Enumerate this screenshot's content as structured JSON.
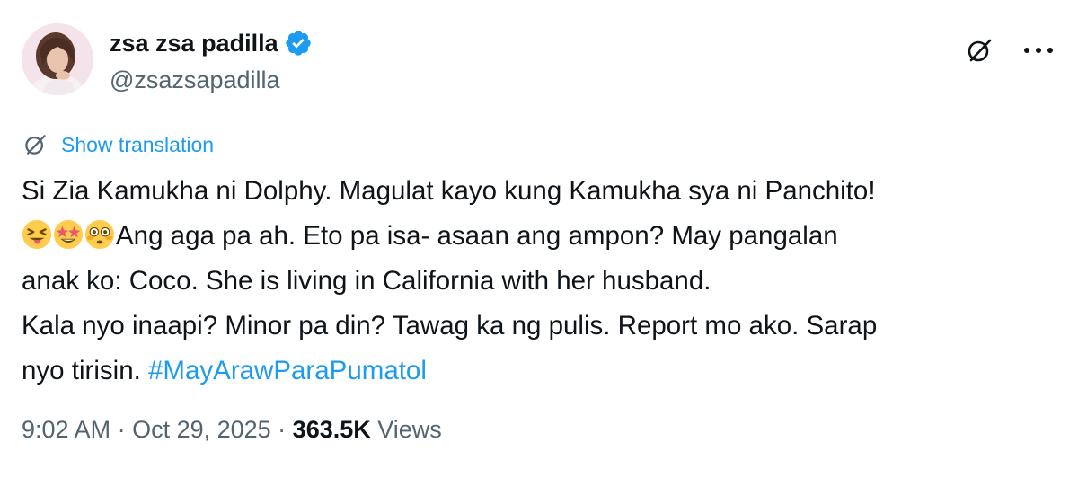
{
  "author": {
    "display_name": "zsa zsa padilla",
    "handle": "@zsazsapadilla",
    "verified": true,
    "avatar": "profile-photo"
  },
  "actions": {
    "grok_icon": "grok-icon",
    "more_icon": "more-icon"
  },
  "translation": {
    "icon": "translate-icon",
    "label": "Show translation"
  },
  "tweet": {
    "line1": "Si Zia Kamukha ni Dolphy. Magulat kayo kung Kamukha sya ni Panchito!",
    "emojis": [
      "squinting-face-with-tongue",
      "star-struck",
      "flushed-face"
    ],
    "line2_rest": "Ang aga pa ah. Eto pa isa- asaan ang ampon? May pangalan",
    "line3": "anak ko: Coco. She is living in California with her husband.",
    "line4": "Kala nyo inaapi? Minor pa din? Tawag ka ng pulis. Report mo ako. Sarap",
    "line5_prefix": "nyo tirisin. ",
    "hashtag": "#MayArawParaPumatol"
  },
  "meta": {
    "time": "9:02 AM",
    "sep1": " · ",
    "date": "Oct 29, 2025",
    "sep2": " · ",
    "views_count": "363.5K",
    "views_label": " Views"
  },
  "colors": {
    "link": "#1d9bf0",
    "secondary_text": "#536471",
    "primary_text": "#0f1419",
    "verified": "#1d9bf0"
  }
}
